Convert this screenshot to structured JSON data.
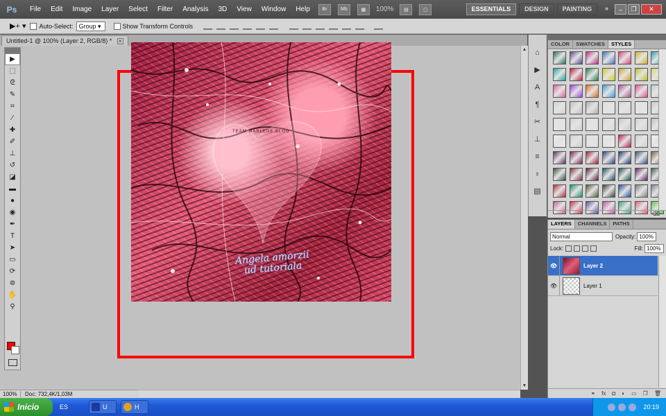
{
  "app": {
    "logo": "Ps"
  },
  "menu": [
    "File",
    "Edit",
    "Image",
    "Layer",
    "Select",
    "Filter",
    "Analysis",
    "3D",
    "View",
    "Window",
    "Help"
  ],
  "menubar": {
    "bridge_label": "Br",
    "minibridge_label": "Mb",
    "zoom_label": "100%",
    "workspaces": [
      "ESSENTIALS",
      "DESIGN",
      "PAINTING"
    ],
    "more": "»",
    "window_controls": [
      "–",
      "❐",
      "✕"
    ]
  },
  "options": {
    "auto_select_label": "Auto-Select:",
    "auto_select_value": "Group",
    "show_transform_label": "Show Transform Controls"
  },
  "document": {
    "tab_title": "Untitled-1 @ 100% (Layer 2, RGB/8) *",
    "watermark": "TEAM MARLENE.BLOG",
    "signature_line1": "Angela amorzii",
    "signature_line2": "ud tutoriala"
  },
  "status": {
    "zoom": "100%",
    "doc_info": "Doc: 732,4K/1,03M"
  },
  "styles_panel": {
    "tabs": [
      "COLOR",
      "SWATCHES",
      "STYLES"
    ],
    "active_tab": "STYLES",
    "cells": [
      "#2a6e5e",
      "#5a4b8a",
      "#c03080",
      "#4a70c0",
      "#e04080",
      "#d0b030",
      "#30a0b0",
      "#20a0a0",
      "#c02040",
      "#2a8050",
      "#d0d020",
      "#d0a020",
      "#c0c020",
      "#d0e060",
      "#e060a0",
      "#a040e0",
      "#e07020",
      "#40a0e0",
      "#b05090",
      "#e05090",
      "#c0d0d0",
      "#d0d0d0",
      "#c0c0c0",
      "#b0b0b0",
      "#e0e0e0",
      "#d8d8d8",
      "#e4e4e4",
      "#c8c8c8",
      "#e0e0e0",
      "#d0d0d0",
      "#e0e0e0",
      "#d8d8d8",
      "#c8c8c8",
      "#d0d0d0",
      "#c0c0c0",
      "#ececec",
      "#d0d0d0",
      "#e0e0e0",
      "#e8e8e8",
      "#c0205a",
      "#d0d0d0",
      "#f0f0f0",
      "#5a3060",
      "#802050",
      "#a02040",
      "#304080",
      "#203870",
      "#405080",
      "#806040",
      "#3a5040",
      "#803040",
      "#602040",
      "#205060",
      "#205050",
      "#602060",
      "#406050",
      "#b03040",
      "#209070",
      "#506030",
      "#404040",
      "#2050a0",
      "#808080",
      "#8080a0",
      "#c06090",
      "#d03050",
      "#6050a0",
      "#c050a0",
      "#40a080",
      "#e06080",
      "#60c040"
    ],
    "footer_icons": [
      "fx",
      "new",
      "delete"
    ]
  },
  "layers_panel": {
    "tabs": [
      "LAYERS",
      "CHANNELS",
      "PATHS"
    ],
    "active_tab": "LAYERS",
    "blend_mode": "Normal",
    "opacity_label": "Opacity:",
    "opacity_value": "100%",
    "lock_label": "Lock:",
    "fill_label": "Fill:",
    "fill_value": "100%",
    "layers": [
      {
        "name": "Layer 2",
        "active": true,
        "thumb": "art"
      },
      {
        "name": "Layer 1",
        "active": false,
        "thumb": "empty"
      }
    ],
    "footer_icons": [
      "link",
      "fx",
      "mask",
      "adjust",
      "group",
      "new",
      "trash"
    ]
  },
  "taskbar": {
    "start_label": "Inicio",
    "language": "ES",
    "tasks": [
      {
        "label": "U",
        "color": "#1a3aa0"
      },
      {
        "label": "H",
        "color": "#e0a020"
      }
    ],
    "clock": "20:19"
  }
}
